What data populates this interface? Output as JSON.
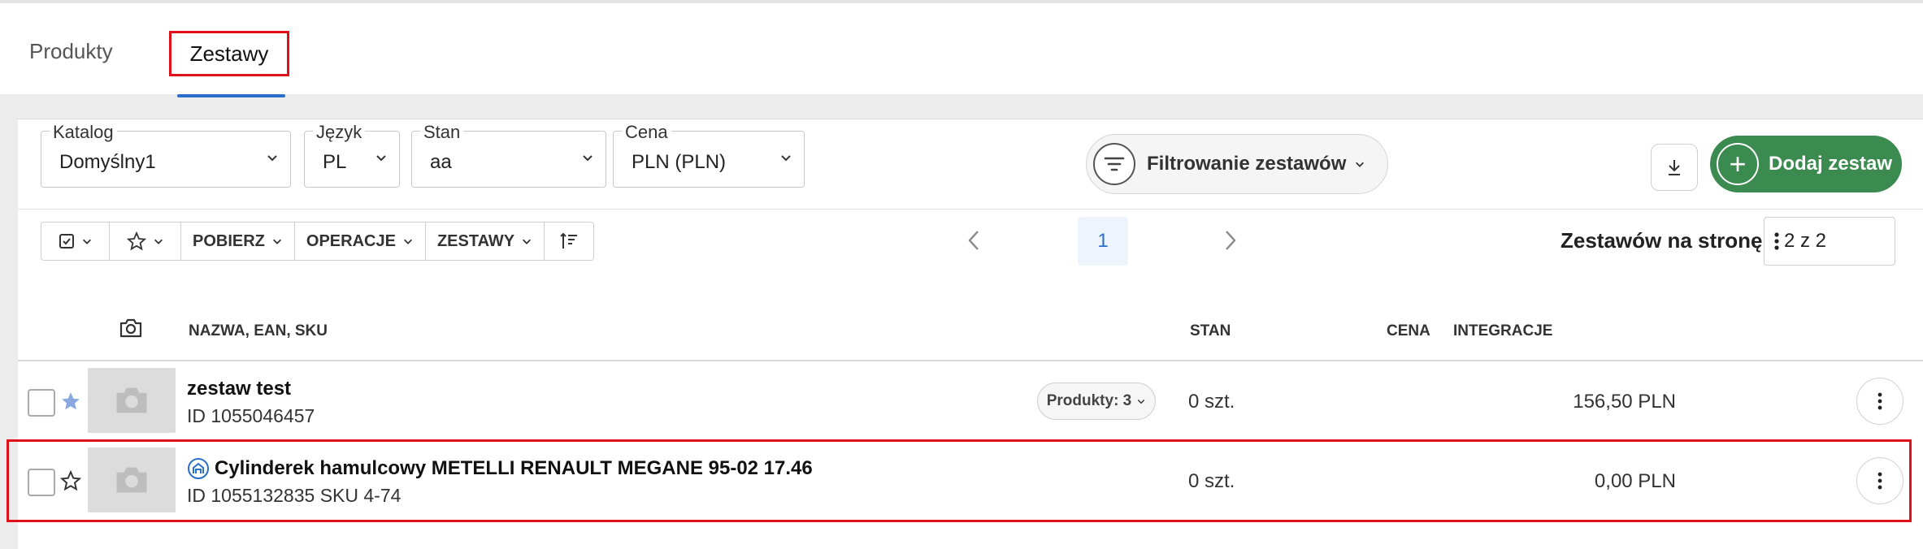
{
  "tabs": [
    {
      "label": "Produkty"
    },
    {
      "label": "Zestawy",
      "active": true
    }
  ],
  "filters": {
    "katalog": {
      "label": "Katalog",
      "value": "Domyślny1"
    },
    "jezyk": {
      "label": "Język",
      "value": "PL"
    },
    "stan": {
      "label": "Stan",
      "value": "aa"
    },
    "cena": {
      "label": "Cena",
      "value": "PLN (PLN)"
    }
  },
  "filter_button": {
    "label": "Filtrowanie zestawów"
  },
  "add_button": {
    "label": "Dodaj zestaw"
  },
  "toolbar": {
    "pobierz": "POBIERZ",
    "operacje": "OPERACJE",
    "zestawy": "ZESTAWY"
  },
  "pager": {
    "current": "1"
  },
  "per_page": {
    "label": "Zestawów na stronę",
    "value": "2 z 2"
  },
  "columns": {
    "name": "NAZWA, EAN, SKU",
    "stan": "STAN",
    "cena": "CENA",
    "integracje": "INTEGRACJE"
  },
  "rows": [
    {
      "name": "zestaw test",
      "id": "ID 1055046457",
      "badge": "Produkty: 3",
      "stan": "0 szt.",
      "cena": "156,50 PLN",
      "starred": true
    },
    {
      "name": "Cylinderek hamulcowy METELLI RENAULT MEGANE 95-02 17.46",
      "id": "ID 1055132835 SKU 4-74",
      "stan": "0 szt.",
      "cena": "0,00 PLN",
      "starred": false
    }
  ],
  "colors": {
    "accent": "#2a6fca",
    "add_button": "#3b8a4f",
    "highlight": "#e0101b"
  }
}
